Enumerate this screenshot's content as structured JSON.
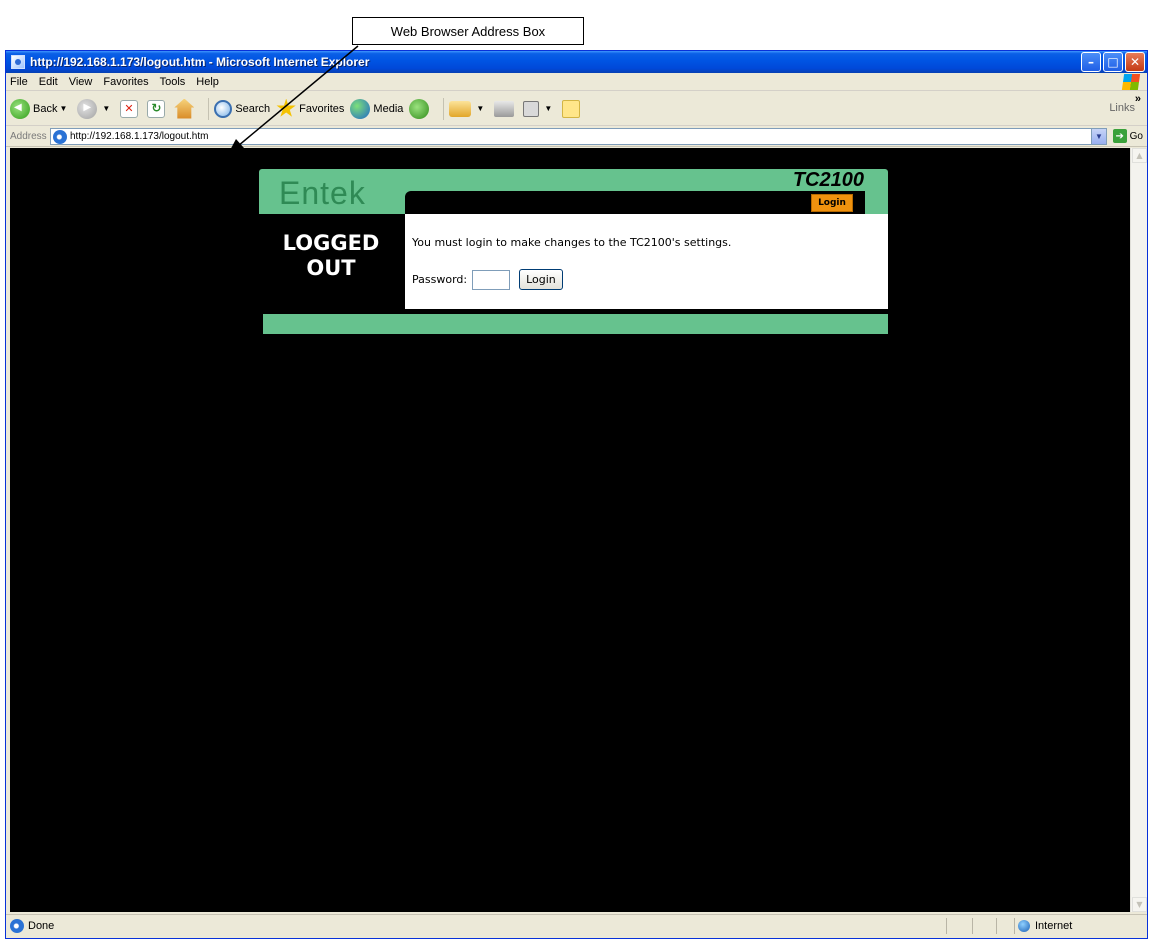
{
  "annotation": {
    "label": "Web Browser Address Box"
  },
  "window": {
    "title": "http://192.168.1.173/logout.htm - Microsoft Internet Explorer",
    "controls": {
      "minimize": "–",
      "maximize": "□",
      "close": "✕"
    }
  },
  "menu": {
    "items": [
      "File",
      "Edit",
      "View",
      "Favorites",
      "Tools",
      "Help"
    ]
  },
  "toolbar": {
    "back_label": "Back",
    "search_label": "Search",
    "favorites_label": "Favorites",
    "media_label": "Media",
    "links_label": "Links"
  },
  "address": {
    "label": "Address",
    "url": "http://192.168.1.173/logout.htm",
    "go_label": "Go"
  },
  "page": {
    "logo": "Entek",
    "model": "TC2100",
    "tab_login": "Login",
    "status_line1": "LOGGED",
    "status_line2": "OUT",
    "message": "You must login to make changes to the TC2100's settings.",
    "password_label": "Password:",
    "login_button": "Login",
    "colors": {
      "green": "#66c28e",
      "orange": "#f0920e",
      "background": "#000000"
    }
  },
  "status": {
    "text": "Done",
    "zone": "Internet"
  }
}
